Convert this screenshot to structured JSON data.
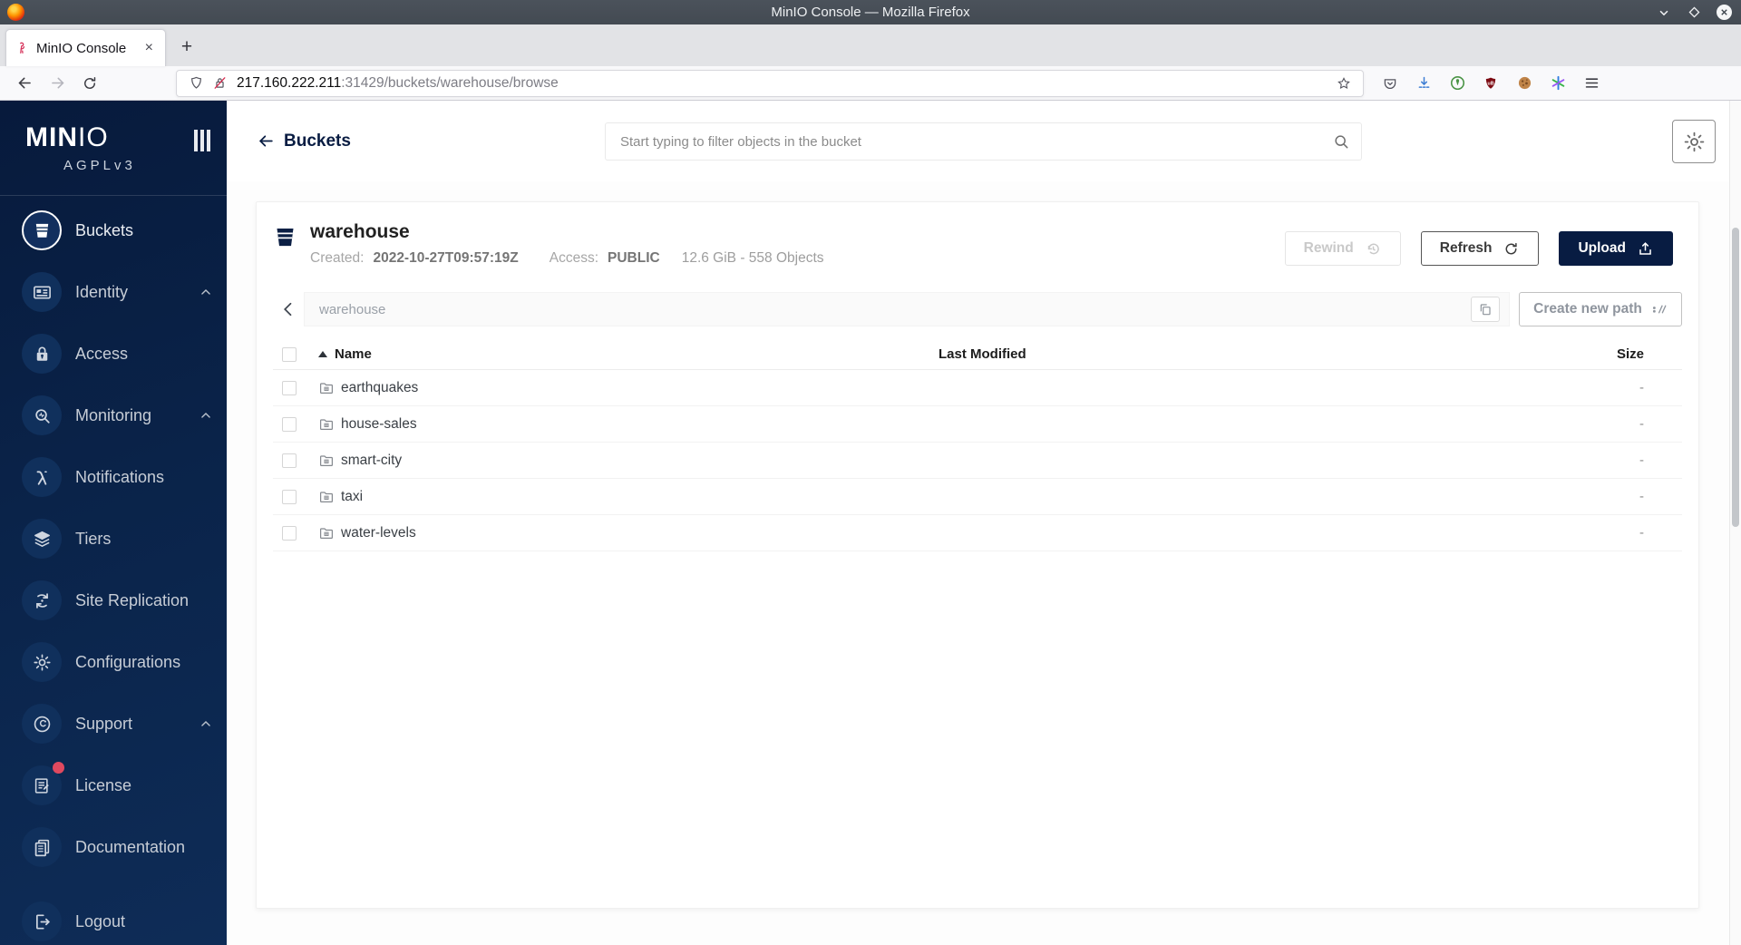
{
  "browser": {
    "window_title": "MinIO Console — Mozilla Firefox",
    "tab_title": "MinIO Console",
    "close_tab_label": "×",
    "new_tab_label": "+",
    "url_host": "217.160.222.211",
    "url_path": ":31429/buckets/warehouse/browse"
  },
  "sidebar": {
    "logo_bold": "MIN",
    "logo_light": "IO",
    "license_tag": "AGPLv3",
    "items": [
      {
        "label": "Buckets",
        "icon": "bucket",
        "active": true
      },
      {
        "label": "Identity",
        "icon": "id-card",
        "chevron": true
      },
      {
        "label": "Access",
        "icon": "lock"
      },
      {
        "label": "Monitoring",
        "icon": "monitor-search",
        "chevron": true
      },
      {
        "label": "Notifications",
        "icon": "lambda"
      },
      {
        "label": "Tiers",
        "icon": "layers"
      },
      {
        "label": "Site Replication",
        "icon": "sync"
      },
      {
        "label": "Configurations",
        "icon": "gear"
      },
      {
        "label": "Support",
        "icon": "support",
        "chevron": true
      },
      {
        "label": "License",
        "icon": "license",
        "badge": true
      },
      {
        "label": "Documentation",
        "icon": "docs"
      },
      {
        "label": "Logout",
        "icon": "logout"
      }
    ]
  },
  "header": {
    "back_label": "Buckets",
    "search_placeholder": "Start typing to filter objects in the bucket"
  },
  "bucket": {
    "name": "warehouse",
    "created_label": "Created:",
    "created_value": "2022-10-27T09:57:19Z",
    "access_label": "Access:",
    "access_value": "PUBLIC",
    "usage": "12.6 GiB - 558 Objects",
    "rewind_label": "Rewind",
    "refresh_label": "Refresh",
    "upload_label": "Upload"
  },
  "pathbar": {
    "current_path": "warehouse",
    "create_path_label": "Create new path"
  },
  "table": {
    "name_header": "Name",
    "modified_header": "Last Modified",
    "size_header": "Size",
    "rows": [
      {
        "name": "earthquakes",
        "size": "-"
      },
      {
        "name": "house-sales",
        "size": "-"
      },
      {
        "name": "smart-city",
        "size": "-"
      },
      {
        "name": "taxi",
        "size": "-"
      },
      {
        "name": "water-levels",
        "size": "-"
      }
    ]
  },
  "colors": {
    "accent_navy": "#081C42",
    "badge_red": "#e0495f",
    "download_blue": "#3f7fd4"
  }
}
